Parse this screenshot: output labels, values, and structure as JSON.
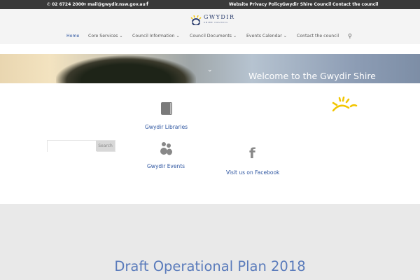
{
  "topbar": {
    "phone": "02 6724 2000",
    "email": "mail@gwydir.nsw.gov.au",
    "links": [
      "Website Privacy Policy",
      "Gwydir Shire Council",
      "Contact the council"
    ]
  },
  "logo": {
    "name": "GWYDIR",
    "sub": "SHIRE COUNCIL"
  },
  "nav": [
    "Home",
    "Core Services",
    "Council Information",
    "Council Documents",
    "Events Calendar",
    "Contact the council"
  ],
  "hero": {
    "title": "Welcome to the Gwydir Shire"
  },
  "search": {
    "button": "Search",
    "placeholder": ""
  },
  "links": {
    "libraries": "Gwydir Libraries",
    "events": "Gwydir Events",
    "facebook": "Visit us on Facebook"
  },
  "section": {
    "heading": "Draft Operational Plan 2018"
  },
  "colors": {
    "link": "#2d55a0",
    "heading": "#5a7bbb",
    "topbar": "#3a3a3a"
  }
}
